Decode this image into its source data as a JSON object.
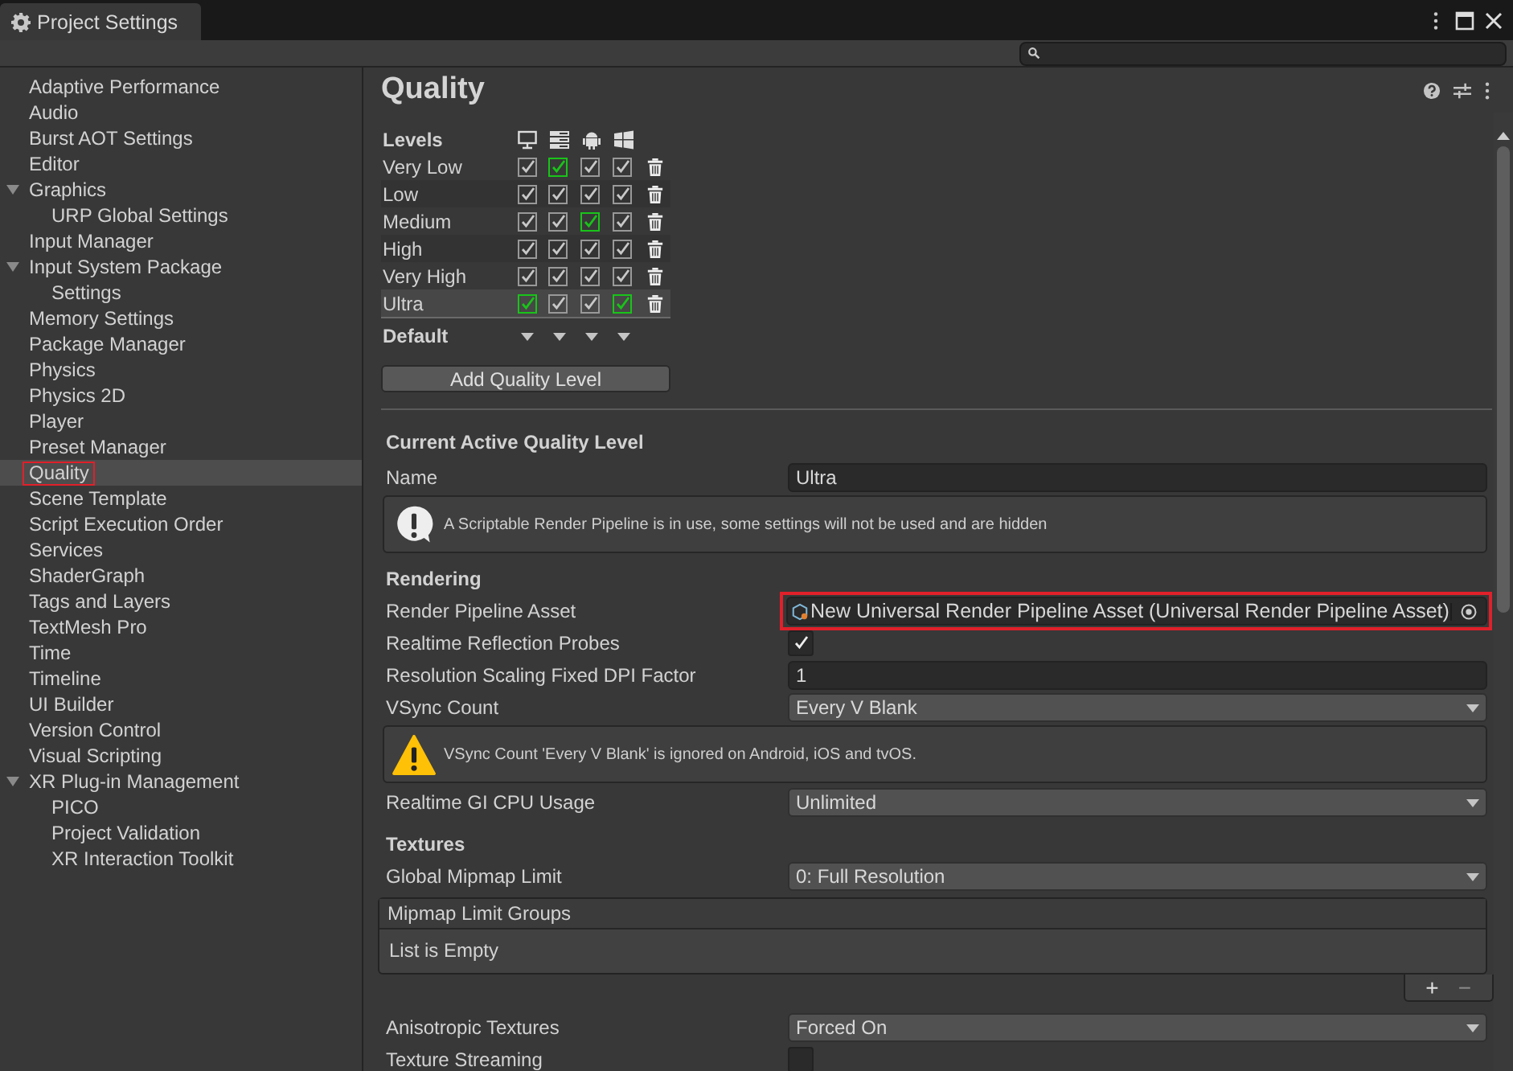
{
  "window": {
    "title": "Project Settings"
  },
  "sidebar": {
    "items": [
      {
        "label": "Adaptive Performance",
        "selected": false,
        "marked": false
      },
      {
        "label": "Audio",
        "selected": false,
        "marked": false
      },
      {
        "label": "Burst AOT Settings",
        "selected": false,
        "marked": false
      },
      {
        "label": "Editor",
        "selected": false,
        "marked": false
      },
      {
        "label": "Graphics",
        "selected": false,
        "marked": false,
        "expanded": true,
        "children": [
          {
            "label": "URP Global Settings",
            "selected": false,
            "marked": false
          }
        ]
      },
      {
        "label": "Input Manager",
        "selected": false,
        "marked": false
      },
      {
        "label": "Input System Package",
        "selected": false,
        "marked": false,
        "expanded": true,
        "children": [
          {
            "label": "Settings",
            "selected": false,
            "marked": false
          }
        ]
      },
      {
        "label": "Memory Settings",
        "selected": false,
        "marked": false
      },
      {
        "label": "Package Manager",
        "selected": false,
        "marked": false
      },
      {
        "label": "Physics",
        "selected": false,
        "marked": false
      },
      {
        "label": "Physics 2D",
        "selected": false,
        "marked": false
      },
      {
        "label": "Player",
        "selected": false,
        "marked": false
      },
      {
        "label": "Preset Manager",
        "selected": false,
        "marked": false
      },
      {
        "label": "Quality",
        "selected": true,
        "marked": true
      },
      {
        "label": "Scene Template",
        "selected": false,
        "marked": false
      },
      {
        "label": "Script Execution Order",
        "selected": false,
        "marked": false
      },
      {
        "label": "Services",
        "selected": false,
        "marked": false
      },
      {
        "label": "ShaderGraph",
        "selected": false,
        "marked": false
      },
      {
        "label": "Tags and Layers",
        "selected": false,
        "marked": false
      },
      {
        "label": "TextMesh Pro",
        "selected": false,
        "marked": false
      },
      {
        "label": "Time",
        "selected": false,
        "marked": false
      },
      {
        "label": "Timeline",
        "selected": false,
        "marked": false
      },
      {
        "label": "UI Builder",
        "selected": false,
        "marked": false
      },
      {
        "label": "Version Control",
        "selected": false,
        "marked": false
      },
      {
        "label": "Visual Scripting",
        "selected": false,
        "marked": false
      },
      {
        "label": "XR Plug-in Management",
        "selected": false,
        "marked": false,
        "expanded": true,
        "children": [
          {
            "label": "PICO",
            "selected": false,
            "marked": false
          },
          {
            "label": "Project Validation",
            "selected": false,
            "marked": false
          },
          {
            "label": "XR Interaction Toolkit",
            "selected": false,
            "marked": false
          }
        ]
      }
    ]
  },
  "page": {
    "title": "Quality"
  },
  "levels": {
    "heading": "Levels",
    "platforms": [
      {
        "kind": "desktop"
      },
      {
        "kind": "server"
      },
      {
        "kind": "android"
      },
      {
        "kind": "windows"
      }
    ],
    "rows": [
      {
        "name": "Very Low",
        "selected": false,
        "checks": [
          {
            "checked": true,
            "default": false
          },
          {
            "checked": true,
            "default": true
          },
          {
            "checked": true,
            "default": false
          },
          {
            "checked": true,
            "default": false
          }
        ]
      },
      {
        "name": "Low",
        "selected": false,
        "checks": [
          {
            "checked": true,
            "default": false
          },
          {
            "checked": true,
            "default": false
          },
          {
            "checked": true,
            "default": false
          },
          {
            "checked": true,
            "default": false
          }
        ]
      },
      {
        "name": "Medium",
        "selected": false,
        "checks": [
          {
            "checked": true,
            "default": false
          },
          {
            "checked": true,
            "default": false
          },
          {
            "checked": true,
            "default": true
          },
          {
            "checked": true,
            "default": false
          }
        ]
      },
      {
        "name": "High",
        "selected": false,
        "checks": [
          {
            "checked": true,
            "default": false
          },
          {
            "checked": true,
            "default": false
          },
          {
            "checked": true,
            "default": false
          },
          {
            "checked": true,
            "default": false
          }
        ]
      },
      {
        "name": "Very High",
        "selected": false,
        "checks": [
          {
            "checked": true,
            "default": false
          },
          {
            "checked": true,
            "default": false
          },
          {
            "checked": true,
            "default": false
          },
          {
            "checked": true,
            "default": false
          }
        ]
      },
      {
        "name": "Ultra",
        "selected": true,
        "checks": [
          {
            "checked": true,
            "default": true
          },
          {
            "checked": true,
            "default": false
          },
          {
            "checked": true,
            "default": false
          },
          {
            "checked": true,
            "default": true
          }
        ]
      }
    ],
    "default_label": "Default",
    "add_button": "Add Quality Level"
  },
  "properties": [
    {
      "kind": "header",
      "label": "Current Active Quality Level"
    },
    {
      "kind": "text",
      "label": "Name",
      "value": "Ultra"
    },
    {
      "kind": "info",
      "text": "A Scriptable Render Pipeline is in use, some settings will not be used and are hidden"
    },
    {
      "kind": "header",
      "label": "Rendering"
    },
    {
      "kind": "object",
      "label": "Render Pipeline Asset",
      "value": "New Universal Render Pipeline Asset (Universal Render Pipeline Asset)",
      "marked": true
    },
    {
      "kind": "checkbox",
      "label": "Realtime Reflection Probes",
      "checked": true
    },
    {
      "kind": "text",
      "label": "Resolution Scaling Fixed DPI Factor",
      "value": "1"
    },
    {
      "kind": "dropdown",
      "label": "VSync Count",
      "value": "Every V Blank"
    },
    {
      "kind": "warning",
      "text": "VSync Count 'Every V Blank' is ignored on Android, iOS and tvOS."
    },
    {
      "kind": "dropdown",
      "label": "Realtime GI CPU Usage",
      "value": "Unlimited"
    },
    {
      "kind": "header",
      "label": "Textures"
    },
    {
      "kind": "dropdown",
      "label": "Global Mipmap Limit",
      "value": "0: Full Resolution"
    },
    {
      "kind": "list",
      "label": "Mipmap Limit Groups",
      "empty": "List is Empty",
      "add": "+",
      "remove": "−"
    },
    {
      "kind": "dropdown",
      "label": "Anisotropic Textures",
      "value": "Forced On"
    },
    {
      "kind": "checkbox",
      "label": "Texture Streaming",
      "checked": false
    }
  ]
}
